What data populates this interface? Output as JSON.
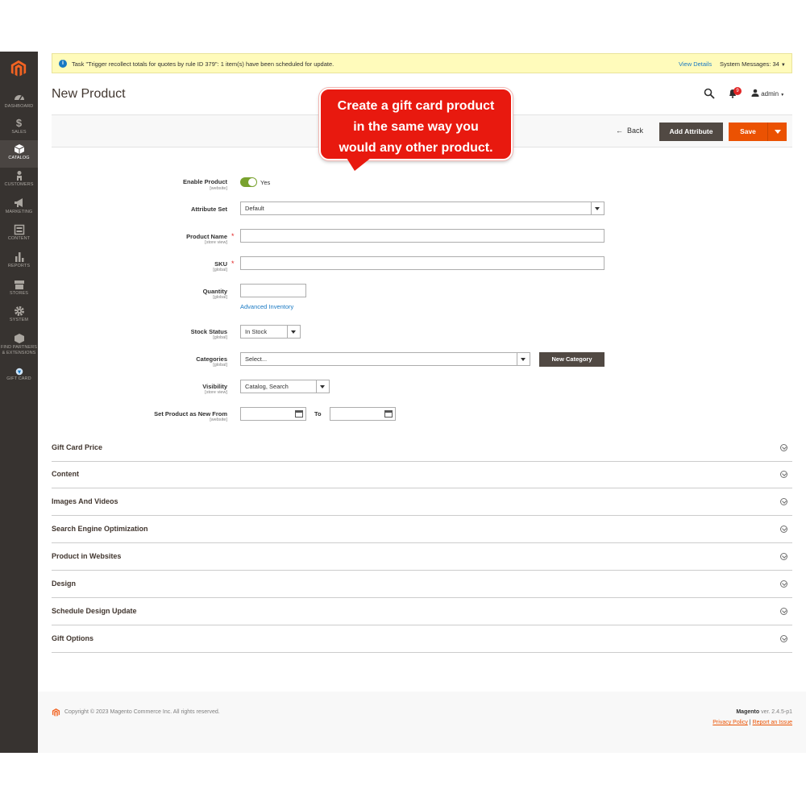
{
  "message_bar": {
    "text": "Task \"Trigger recollect totals for quotes by rule ID 379\": 1 item(s) have been scheduled for update.",
    "view_details": "View Details",
    "system_messages": "System Messages: 34"
  },
  "sidebar": {
    "items": [
      {
        "label": "DASHBOARD",
        "icon": "dashboard-icon"
      },
      {
        "label": "SALES",
        "icon": "dollar-icon"
      },
      {
        "label": "CATALOG",
        "icon": "cube-icon",
        "active": true
      },
      {
        "label": "CUSTOMERS",
        "icon": "person-icon"
      },
      {
        "label": "MARKETING",
        "icon": "megaphone-icon"
      },
      {
        "label": "CONTENT",
        "icon": "content-icon"
      },
      {
        "label": "REPORTS",
        "icon": "bar-chart-icon"
      },
      {
        "label": "STORES",
        "icon": "store-icon"
      },
      {
        "label": "SYSTEM",
        "icon": "gear-icon"
      },
      {
        "label": "FIND PARTNERS",
        "label2": "& EXTENSIONS",
        "icon": "partners-icon"
      },
      {
        "label": "GIFT CARD",
        "icon": "gift-card-icon"
      }
    ]
  },
  "header": {
    "title": "New Product",
    "notifications_count": "9",
    "user": "admin"
  },
  "actions": {
    "back": "Back",
    "add_attribute": "Add Attribute",
    "save": "Save"
  },
  "callout": {
    "line1": "Create a gift card product",
    "line2": "in the same way you",
    "line3": "would any other product."
  },
  "form": {
    "enable_product": {
      "label": "Enable Product",
      "scope": "[website]",
      "value": "Yes"
    },
    "attribute_set": {
      "label": "Attribute Set",
      "value": "Default"
    },
    "product_name": {
      "label": "Product Name",
      "scope": "[store view]",
      "required": "*",
      "value": ""
    },
    "sku": {
      "label": "SKU",
      "scope": "[global]",
      "required": "*",
      "value": ""
    },
    "quantity": {
      "label": "Quantity",
      "scope": "[global]",
      "value": "",
      "link": "Advanced Inventory"
    },
    "stock_status": {
      "label": "Stock Status",
      "scope": "[global]",
      "value": "In Stock"
    },
    "categories": {
      "label": "Categories",
      "scope": "[global]",
      "value": "Select...",
      "button": "New Category"
    },
    "visibility": {
      "label": "Visibility",
      "scope": "[store view]",
      "value": "Catalog, Search"
    },
    "new_from": {
      "label": "Set Product as New From",
      "scope": "[website]",
      "to_label": "To"
    }
  },
  "sections": [
    "Gift Card Price",
    "Content",
    "Images And Videos",
    "Search Engine Optimization",
    "Product in Websites",
    "Design",
    "Schedule Design Update",
    "Gift Options"
  ],
  "footer": {
    "copyright": "Copyright © 2023 Magento Commerce Inc. All rights reserved.",
    "brand": "Magento",
    "version": "ver. 2.4.5-p1",
    "privacy": "Privacy Policy",
    "separator": "|",
    "report": "Report an Issue"
  },
  "colors": {
    "sidebar_bg": "#373330",
    "accent_orange": "#eb5202",
    "dark_button": "#514943",
    "callout_red": "#e8190f",
    "link_blue": "#1979c3",
    "message_bg": "#fffbbb"
  }
}
